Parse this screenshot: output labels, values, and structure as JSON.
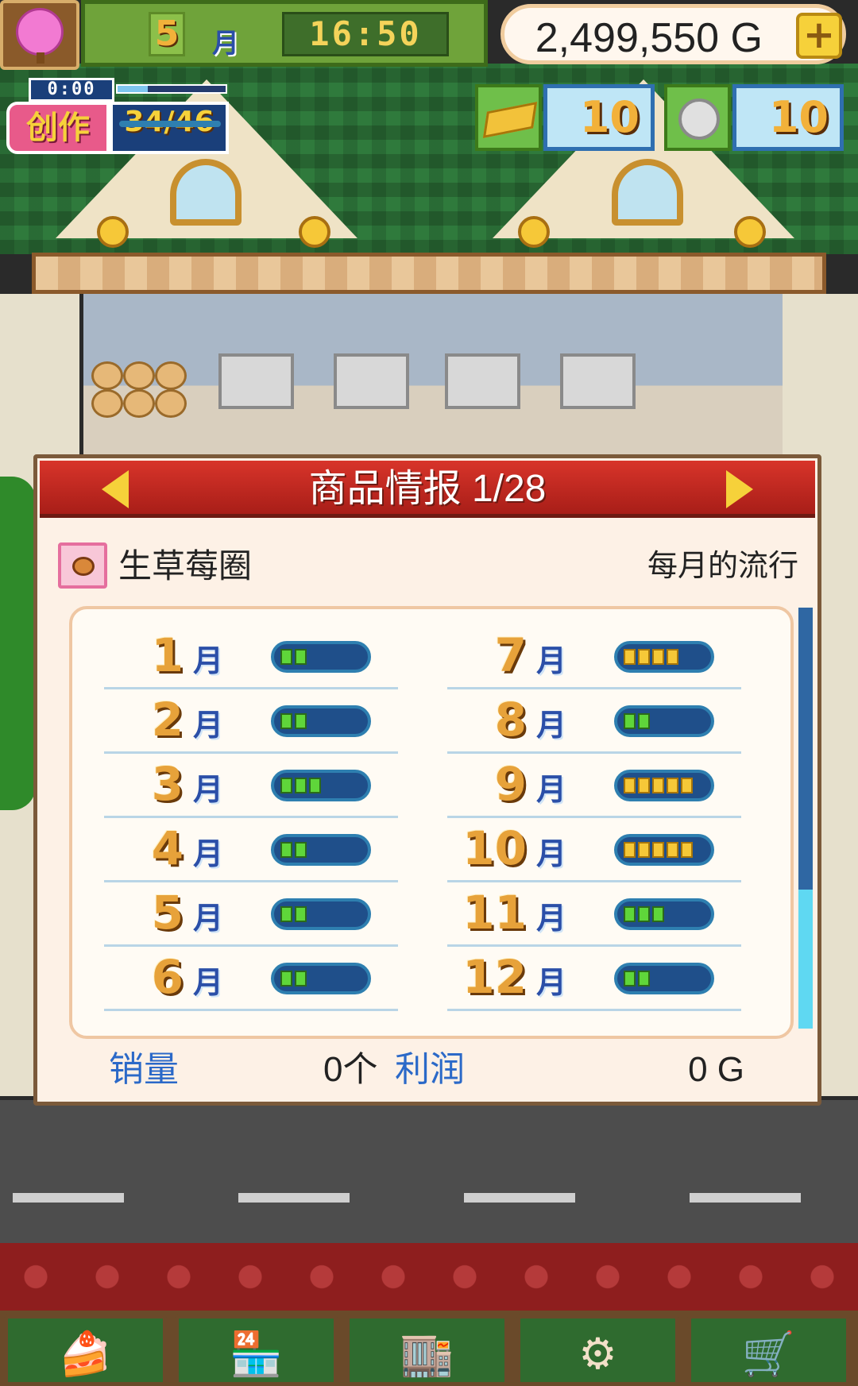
{
  "hud": {
    "month": "5",
    "month_unit": "月",
    "time": "16:50",
    "money": "2,499,550 G",
    "create_timer": "0:00",
    "create_label": "创作",
    "create_count": "34/46",
    "create_progress": 0.28,
    "gold_count": "10",
    "silver_count": "10"
  },
  "panel": {
    "title": "商品情报 1/28",
    "product_name": "生草莓圈",
    "trend_label": "每月的流行",
    "month_unit": "月",
    "months": [
      {
        "num": "1",
        "level": 2
      },
      {
        "num": "2",
        "level": 2
      },
      {
        "num": "3",
        "level": 3
      },
      {
        "num": "4",
        "level": 2
      },
      {
        "num": "5",
        "level": 2
      },
      {
        "num": "6",
        "level": 2
      },
      {
        "num": "7",
        "level": 4
      },
      {
        "num": "8",
        "level": 2
      },
      {
        "num": "9",
        "level": 5
      },
      {
        "num": "10",
        "level": 5
      },
      {
        "num": "11",
        "level": 3
      },
      {
        "num": "12",
        "level": 2
      }
    ],
    "sales_label": "销量",
    "sales_value": "0个",
    "profit_label": "利润",
    "profit_value": "0 G"
  },
  "colors": {
    "header_red": "#c42a22",
    "trend_green": "#5fd63a",
    "trend_yellow": "#f6c838",
    "bar_blue": "#1f4f8a",
    "stat_label_blue": "#2b69c8",
    "scroll_thumb": "#5fd8f2"
  },
  "bottom_nav": [
    "cake-icon",
    "shop-icon",
    "store-front-icon",
    "tools-icon",
    "cart-icon"
  ]
}
